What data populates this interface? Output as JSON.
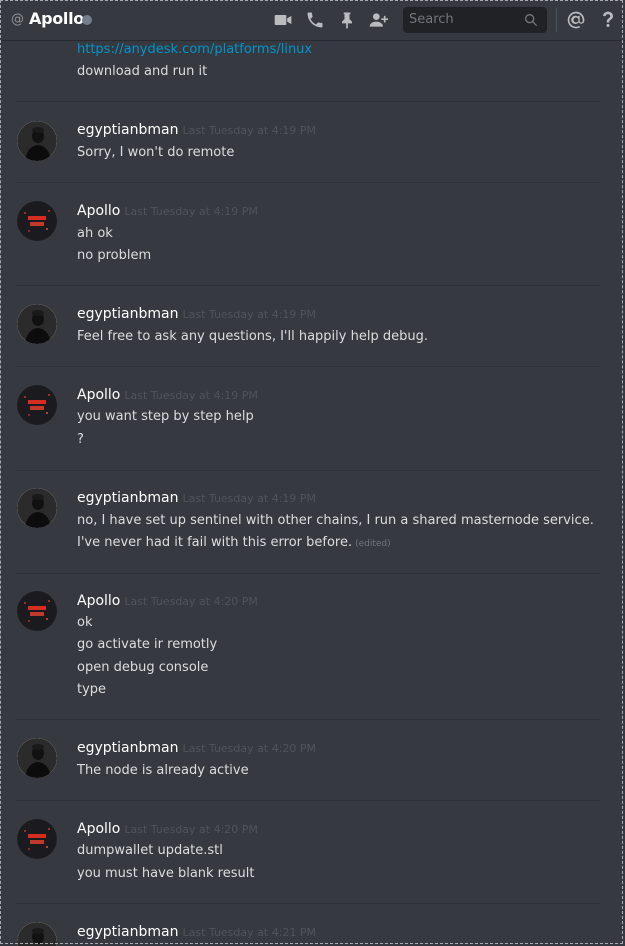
{
  "header": {
    "at": "@",
    "name": "Apollo",
    "search_placeholder": "Search",
    "icons": [
      "video-call-icon",
      "voice-call-icon",
      "pin-icon",
      "add-friend-icon",
      "search-icon",
      "mention-icon",
      "help-icon"
    ]
  },
  "colors": {
    "background": "#36393f",
    "link": "#0096cf",
    "username": "#ffffff",
    "timestamp": "#4f545c"
  },
  "messages": [
    {
      "lines": [
        "https://anydesk.com/platforms/linux",
        "download and run it"
      ]
    },
    {
      "author": "egyptianbman",
      "timestamp": "Last Tuesday at 4:19 PM",
      "lines": [
        "Sorry, I won't do remote"
      ]
    },
    {
      "author": "Apollo",
      "timestamp": "Last Tuesday at 4:19 PM",
      "lines": [
        "ah ok",
        "no problem"
      ]
    },
    {
      "author": "egyptianbman",
      "timestamp": "Last Tuesday at 4:19 PM",
      "lines": [
        "Feel free to ask any questions, I'll happily help debug."
      ]
    },
    {
      "author": "Apollo",
      "timestamp": "Last Tuesday at 4:19 PM",
      "lines": [
        "you want step by step help",
        "?"
      ]
    },
    {
      "author": "egyptianbman",
      "timestamp": "Last Tuesday at 4:19 PM",
      "lines": [
        "no, I have set up sentinel with other chains, I run a shared masternode service.",
        "I've never had it fail with this error before."
      ],
      "edited": "(edited)"
    },
    {
      "author": "Apollo",
      "timestamp": "Last Tuesday at 4:20 PM",
      "lines": [
        "ok",
        "go activate ir remotly",
        "open debug console",
        "type"
      ]
    },
    {
      "author": "egyptianbman",
      "timestamp": "Last Tuesday at 4:20 PM",
      "lines": [
        "The node is already active"
      ]
    },
    {
      "author": "Apollo",
      "timestamp": "Last Tuesday at 4:20 PM",
      "lines": [
        "dumpwallet update.stl",
        "you must have blank result"
      ]
    },
    {
      "author": "egyptianbman",
      "timestamp": "Last Tuesday at 4:21 PM",
      "lines": []
    }
  ]
}
